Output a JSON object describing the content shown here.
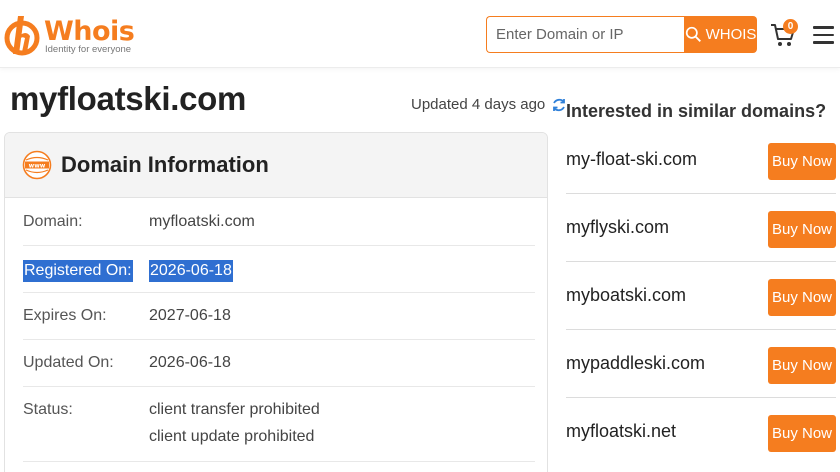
{
  "header": {
    "logo_text": "Whois",
    "logo_tagline": "Identity for everyone",
    "search_placeholder": "Enter Domain or IP",
    "search_button": "WHOIS",
    "cart_count": "0"
  },
  "main": {
    "domain": "myfloatski.com",
    "updated": "Updated 4 days ago",
    "card_title": "Domain Information",
    "fields": {
      "domain_label": "Domain:",
      "domain_value": "myfloatski.com",
      "registered_label": "Registered On:",
      "registered_value": "2026-06-18",
      "expires_label": "Expires On:",
      "expires_value": "2027-06-18",
      "updated_label": "Updated On:",
      "updated_value": "2026-06-18",
      "status_label": "Status:",
      "status_values": [
        "client transfer prohibited",
        "client update prohibited"
      ]
    }
  },
  "sidebar": {
    "title": "Interested in similar domains?",
    "buy_label": "Buy Now",
    "domains": [
      "my-float-ski.com",
      "myflyski.com",
      "myboatski.com",
      "mypaddleski.com",
      "myfloatski.net"
    ]
  },
  "colors": {
    "accent": "#f57d1f",
    "selection": "#2f6fd1"
  }
}
